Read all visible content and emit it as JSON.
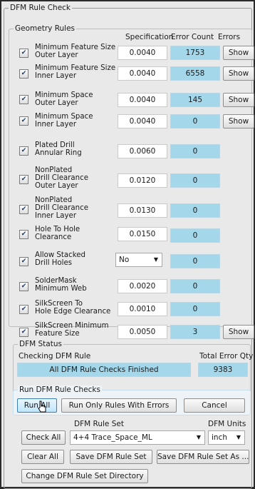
{
  "window": {
    "title": "DFM Rule Check"
  },
  "geometry": {
    "legend": "Geometry Rules",
    "headers": {
      "spec": "Specification",
      "error_count": "Error Count",
      "errors": "Errors"
    },
    "rules": [
      {
        "label": "Minimum Feature Size\nOuter Layer",
        "checked": true,
        "spec": "0.0040",
        "errors": "1753",
        "show": "Show"
      },
      {
        "label": "Minimum Feature Size\nInner Layer",
        "checked": true,
        "spec": "0.0040",
        "errors": "6558",
        "show": "Show"
      },
      {
        "label": "Minimum Space\nOuter Layer",
        "checked": true,
        "spec": "0.0040",
        "errors": "145",
        "show": "Show"
      },
      {
        "label": "Minimum Space\nInner Layer",
        "checked": true,
        "spec": "0.0040",
        "errors": "0",
        "show": "Show"
      },
      {
        "label": "Plated Drill\nAnnular Ring",
        "checked": true,
        "spec": "0.0060",
        "errors": "0"
      },
      {
        "label": "NonPlated\nDrill Clearance\nOuter Layer",
        "checked": true,
        "spec": "0.0120",
        "errors": "0"
      },
      {
        "label": "NonPlated\nDrill Clearance\nInner Layer",
        "checked": true,
        "spec": "0.0130",
        "errors": "0"
      },
      {
        "label": "Hole To Hole\nClearance",
        "checked": true,
        "spec": "0.0150",
        "errors": "0"
      },
      {
        "label": "Allow Stacked\nDrill Holes",
        "checked": true,
        "select": "No",
        "errors": "0"
      },
      {
        "label": "SolderMask\nMinimum Web",
        "checked": true,
        "spec": "0.0020",
        "errors": "0"
      },
      {
        "label": "SilkScreen To\nHole Edge Clearance",
        "checked": true,
        "spec": "0.0010",
        "errors": "0"
      },
      {
        "label": "SilkScreen Minimum\nFeature Size",
        "checked": true,
        "spec": "0.0050",
        "errors": "3",
        "show": "Show"
      }
    ]
  },
  "status": {
    "legend": "DFM Status",
    "checking_label": "Checking DFM Rule",
    "total_label": "Total Error Qty",
    "message": "All DFM Rule Checks Finished",
    "total": "9383"
  },
  "run": {
    "legend": "Run DFM Rule Checks",
    "run_all": "Run All",
    "run_errors": "Run Only Rules With Errors",
    "cancel": "Cancel"
  },
  "ruleset": {
    "set_label": "DFM Rule Set",
    "units_label": "DFM Units",
    "set_value": "4+4 Trace_Space_ML",
    "units_value": "inch",
    "check_all": "Check All",
    "clear_all": "Clear All",
    "save": "Save DFM Rule Set",
    "save_as": "Save DFM Rule Set As ...",
    "change_dir": "Change DFM Rule Set Directory"
  }
}
